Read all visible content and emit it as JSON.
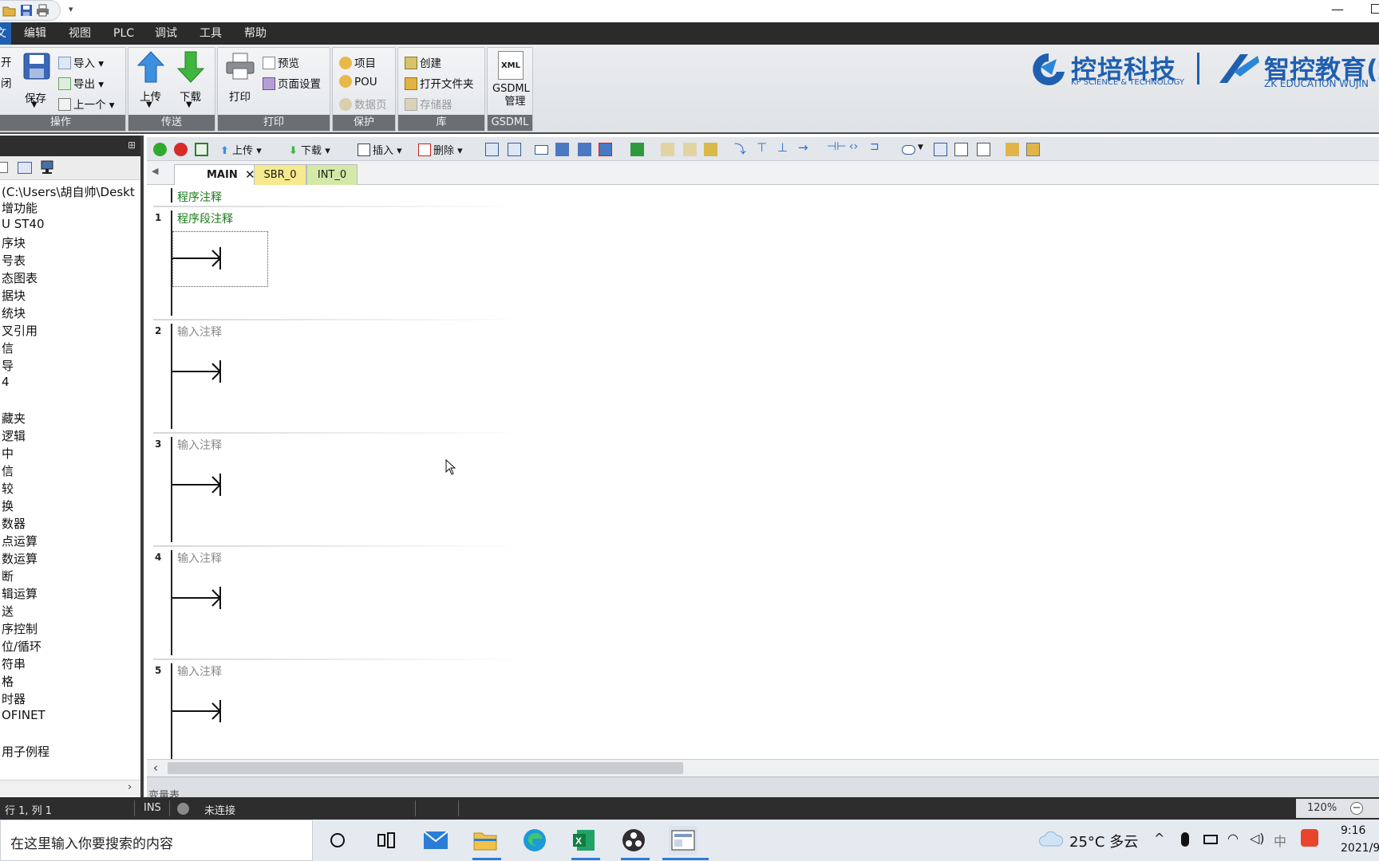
{
  "menu": {
    "items": [
      {
        "label": "文件",
        "name": "menu-file"
      },
      {
        "label": "编辑",
        "name": "menu-edit"
      },
      {
        "label": "视图",
        "name": "menu-view"
      },
      {
        "label": "PLC",
        "name": "menu-plc"
      },
      {
        "label": "调试",
        "name": "menu-debug"
      },
      {
        "label": "工具",
        "name": "menu-tools"
      },
      {
        "label": "帮助",
        "name": "menu-help"
      }
    ]
  },
  "ribbon": {
    "operation": {
      "open": "开",
      "close": "闭",
      "save": "保存",
      "import": "导入",
      "export": "导出",
      "previous": "上一个",
      "label": "操作"
    },
    "transfer": {
      "upload": "上传",
      "download": "下载",
      "label": "传送"
    },
    "print": {
      "print": "打印",
      "preview": "预览",
      "page_setup": "页面设置",
      "label": "打印"
    },
    "protect": {
      "project": "项目",
      "pou": "POU",
      "data_page": "数据页",
      "label": "保护"
    },
    "library": {
      "create": "创建",
      "open_folder": "打开文件夹",
      "memory": "存储器",
      "label": "库"
    },
    "gsdml": {
      "manage_line1": "GSDML",
      "manage_line2": "管理",
      "label": "GSDML",
      "xml_icon_text": "XML"
    }
  },
  "logos": {
    "kp_name": "控培科技",
    "kp_sub": "KP SCIENCE & TECHNOLOGY",
    "zk_name": "智控教育(武",
    "zk_sub": "ZK EDUCATION WUJIN"
  },
  "project_tree": {
    "items": [
      "(C:\\Users\\胡自帅\\Deskt",
      "增功能",
      "U ST40",
      "序块",
      "号表",
      "态图表",
      "据块",
      "统块",
      "叉引用",
      "信",
      "导",
      "4",
      "",
      "藏夹",
      "逻辑",
      "中",
      "信",
      "较",
      "换",
      "数器",
      "点运算",
      "数运算",
      "断",
      "辑运算",
      "送",
      "序控制",
      "位/循环",
      "符串",
      "格",
      "时器",
      "OFINET",
      "",
      "用子例程"
    ]
  },
  "editor_toolbar": {
    "upload": "上传",
    "download": "下载",
    "insert": "插入",
    "delete": "删除"
  },
  "tabs": [
    {
      "label": "MAIN"
    },
    {
      "label": "SBR_0"
    },
    {
      "label": "INT_0"
    }
  ],
  "editor": {
    "program_comment": "程序注释",
    "networks": [
      {
        "number": "1",
        "comment": "程序段注释"
      },
      {
        "number": "2",
        "comment": "输入注释"
      },
      {
        "number": "3",
        "comment": "输入注释"
      },
      {
        "number": "4",
        "comment": "输入注释"
      },
      {
        "number": "5",
        "comment": "输入注释"
      }
    ]
  },
  "var_table": {
    "label": "变量表"
  },
  "status": {
    "position": "行 1, 列 1",
    "mode": "INS",
    "connection": "未连接",
    "zoom": "120%"
  },
  "taskbar": {
    "search_placeholder": "在这里输入你要搜索的内容",
    "weather": "25°C 多云",
    "ime": "中",
    "time": "9:16",
    "date": "2021/9"
  },
  "colors": {
    "comment_green": "#1a7a1a",
    "comment_gray": "#8a8a8a",
    "menubar": "#2b2b2b",
    "accent_blue": "#1f5fb0"
  }
}
